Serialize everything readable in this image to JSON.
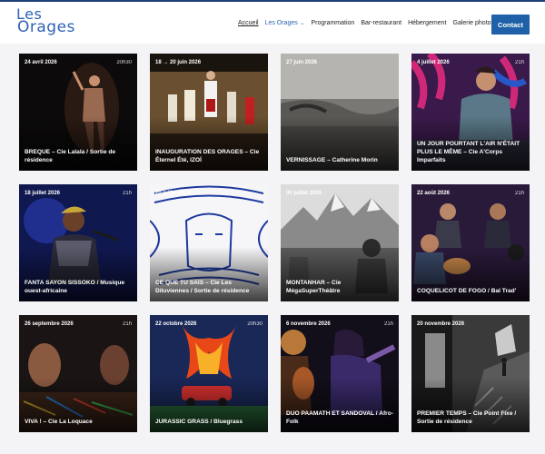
{
  "brand": {
    "line1": "Les",
    "line2": "Orages"
  },
  "nav": {
    "items": [
      {
        "label": "Accueil"
      },
      {
        "label": "Les Orages"
      },
      {
        "label": "Programmation"
      },
      {
        "label": "Bar-restaurant"
      },
      {
        "label": "Hébergement"
      },
      {
        "label": "Galerie photos"
      }
    ],
    "contact_label": "Contact",
    "dropdown_icon": "chevron-down-icon"
  },
  "colors": {
    "accent": "#2e63b5",
    "button": "#1f61a8",
    "background": "#f4f4f6"
  },
  "events": [
    {
      "date": "24 avril 2026",
      "time": "20h30",
      "title": "BREQUE – Cie Lalala / Sortie de résidence"
    },
    {
      "date": "18 → 20 juin 2026",
      "time": "",
      "title": "INAUGURATION DES ORAGES – Cie Éternel Été, IZOÏ"
    },
    {
      "date": "27 juin 2026",
      "time": "",
      "title": "VERNISSAGE – Catherine Morin"
    },
    {
      "date": "4 juillet 2026",
      "time": "21h",
      "title": "UN JOUR POURTANT L'AIR N'ÉTAIT PLUS LE MÊME – Cie A'Corps Imparfaits"
    },
    {
      "date": "18 juillet 2026",
      "time": "21h",
      "title": "FANTA SAYON SISSOKO / Musique ouest-africaine"
    },
    {
      "date": "20 juillet 2026",
      "time": "",
      "title": "CE QUE TU SAIS – Cie Les Diluviennes / Sortie de résidence"
    },
    {
      "date": "30 juillet 2026",
      "time": "",
      "title": "MONTANHAR – Cie MégaSuperThéâtre"
    },
    {
      "date": "22 août 2026",
      "time": "21h",
      "title": "COQUELICOT DE FOGO / Bal Trad'"
    },
    {
      "date": "26 septembre 2026",
      "time": "21h",
      "title": "VIVA ! – Cie La Loquace"
    },
    {
      "date": "22 octobre 2026",
      "time": "20h30",
      "title": "JURASSIC GRASS / Bluegrass"
    },
    {
      "date": "6 novembre 2026",
      "time": "21h",
      "title": "DUO PAAMATH ET SANDOVAL / Afro-Folk"
    },
    {
      "date": "20 novembre 2026",
      "time": "",
      "title": "PREMIER TEMPS – Cie Point Fixe / Sortie de résidence"
    }
  ]
}
